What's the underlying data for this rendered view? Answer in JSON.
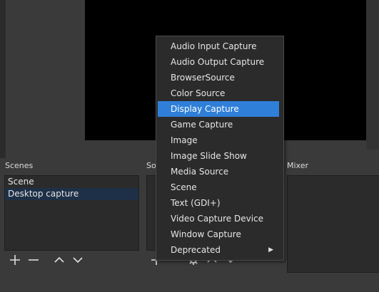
{
  "colors": {
    "menu_highlight": "#2f7fd8",
    "selected_row": "#1e3047",
    "panel_bg": "#2b2b2b",
    "window_bg": "#3a3a3a"
  },
  "scenes": {
    "title": "Scenes",
    "items": [
      {
        "label": "Scene"
      },
      {
        "label": "Desktop capture"
      }
    ]
  },
  "sources": {
    "title": "So"
  },
  "mixer": {
    "title": "Mixer"
  },
  "add_source_menu": {
    "items": [
      {
        "label": "Audio Input Capture"
      },
      {
        "label": "Audio Output Capture"
      },
      {
        "label": "BrowserSource"
      },
      {
        "label": "Color Source"
      },
      {
        "label": "Display Capture"
      },
      {
        "label": "Game Capture"
      },
      {
        "label": "Image"
      },
      {
        "label": "Image Slide Show"
      },
      {
        "label": "Media Source"
      },
      {
        "label": "Scene"
      },
      {
        "label": "Text (GDI+)"
      },
      {
        "label": "Video Capture Device"
      },
      {
        "label": "Window Capture"
      },
      {
        "label": "Deprecated"
      }
    ],
    "highlighted": "Display Capture"
  }
}
